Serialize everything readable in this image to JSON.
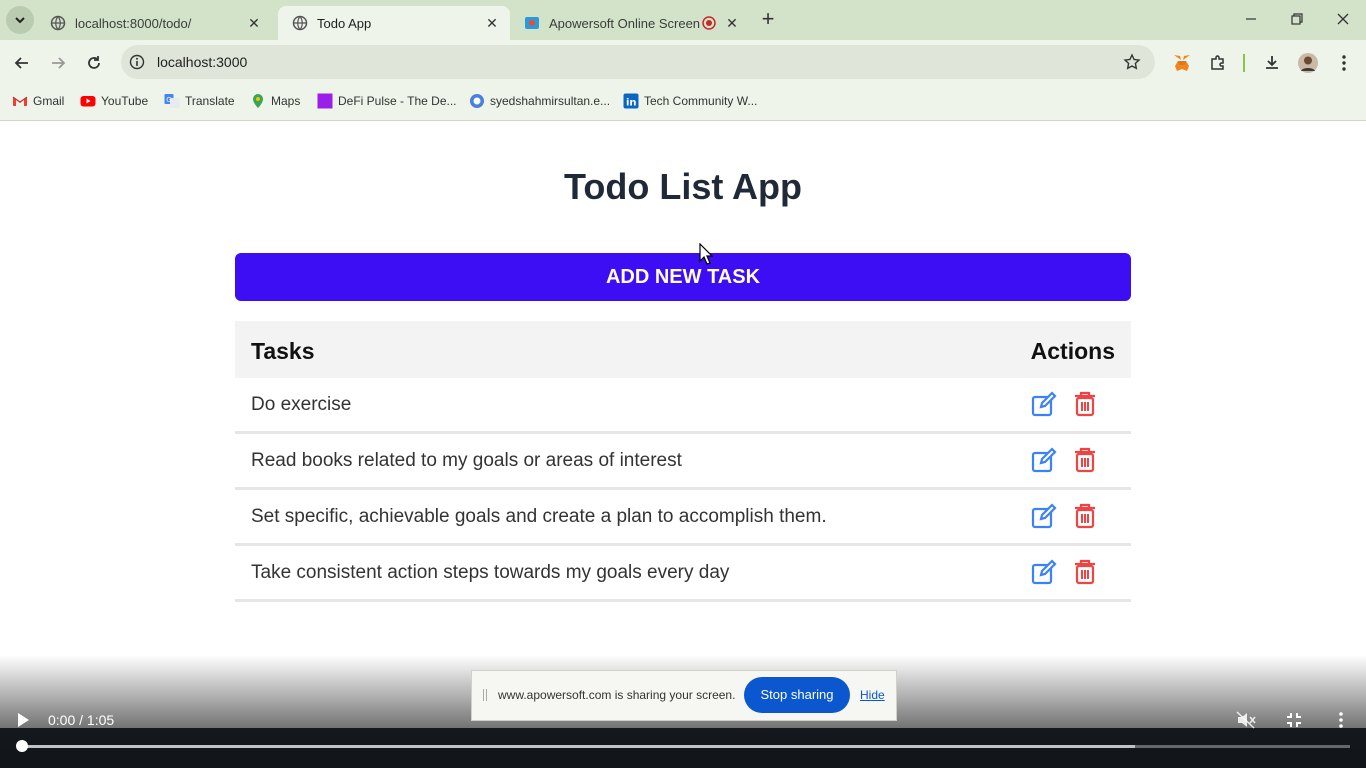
{
  "browser": {
    "tabs": [
      {
        "title": "localhost:8000/todo/",
        "active": false
      },
      {
        "title": "Todo App",
        "active": true
      },
      {
        "title": "Apowersoft Online Screen R",
        "active": false
      }
    ],
    "url": "localhost:3000",
    "bookmarks": [
      {
        "label": "Gmail",
        "icon": "gmail-icon"
      },
      {
        "label": "YouTube",
        "icon": "youtube-icon"
      },
      {
        "label": "Translate",
        "icon": "translate-icon"
      },
      {
        "label": "Maps",
        "icon": "maps-icon"
      },
      {
        "label": "DeFi Pulse - The De...",
        "icon": "defi-pulse-icon"
      },
      {
        "label": "syedshahmirsultan.e...",
        "icon": "site-icon"
      },
      {
        "label": "Tech Community W...",
        "icon": "linkedin-icon"
      }
    ]
  },
  "app": {
    "title": "Todo List App",
    "add_button": "ADD NEW TASK",
    "columns": {
      "tasks": "Tasks",
      "actions": "Actions"
    },
    "tasks": [
      "Do exercise",
      "Read books related to my goals or areas of interest",
      "Set specific, achievable goals and create a plan to accomplish them.",
      "Take consistent action steps towards my goals every day"
    ]
  },
  "share_bar": {
    "text": "www.apowersoft.com is sharing your screen.",
    "stop": "Stop sharing",
    "hide": "Hide"
  },
  "video": {
    "time": "0:00 / 1:05",
    "progress": 0
  },
  "colors": {
    "accent": "#3d0df3",
    "edit": "#3b82f6",
    "delete": "#ef4444",
    "tabstrip": "#d3e3c9"
  }
}
